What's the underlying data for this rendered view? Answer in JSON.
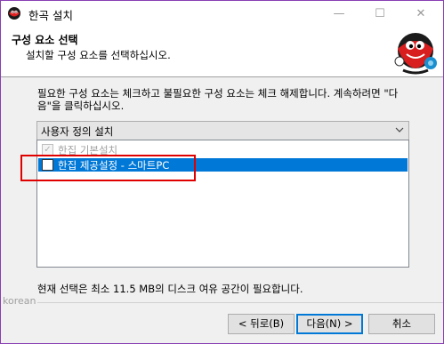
{
  "window": {
    "title": "한곡 설치",
    "minimize_glyph": "—",
    "maximize_glyph": "☐",
    "close_glyph": "✕"
  },
  "header": {
    "title": "구성 요소 선택",
    "subtitle": "설치할 구성 요소를 선택하십시오."
  },
  "instruction": "필요한 구성 요소는 체크하고 불필요한 구성 요소는 체크 해제합니다. 계속하려면 \"다음\"을 클릭하십시오.",
  "install_type": {
    "selected": "사용자 정의 설치"
  },
  "components": [
    {
      "label": "한집 기본설치",
      "checked": true,
      "disabled": true
    },
    {
      "label": "한집 제공설정 - 스마트PC",
      "checked": false,
      "selected": true
    }
  ],
  "space_required": "현재 선택은 최소 11.5 MB의 디스크 여유 공간이 필요합니다.",
  "footer": {
    "brand": "korean",
    "back_label": "< 뒤로(B)",
    "next_label": "다음(N) >",
    "cancel_label": "취소"
  },
  "colors": {
    "accent": "#0078d7",
    "highlight_box": "#e00000",
    "window_border": "#8a3fb3"
  },
  "icons": {
    "app": "app-mascot-icon",
    "header": "mascot-illustration"
  }
}
